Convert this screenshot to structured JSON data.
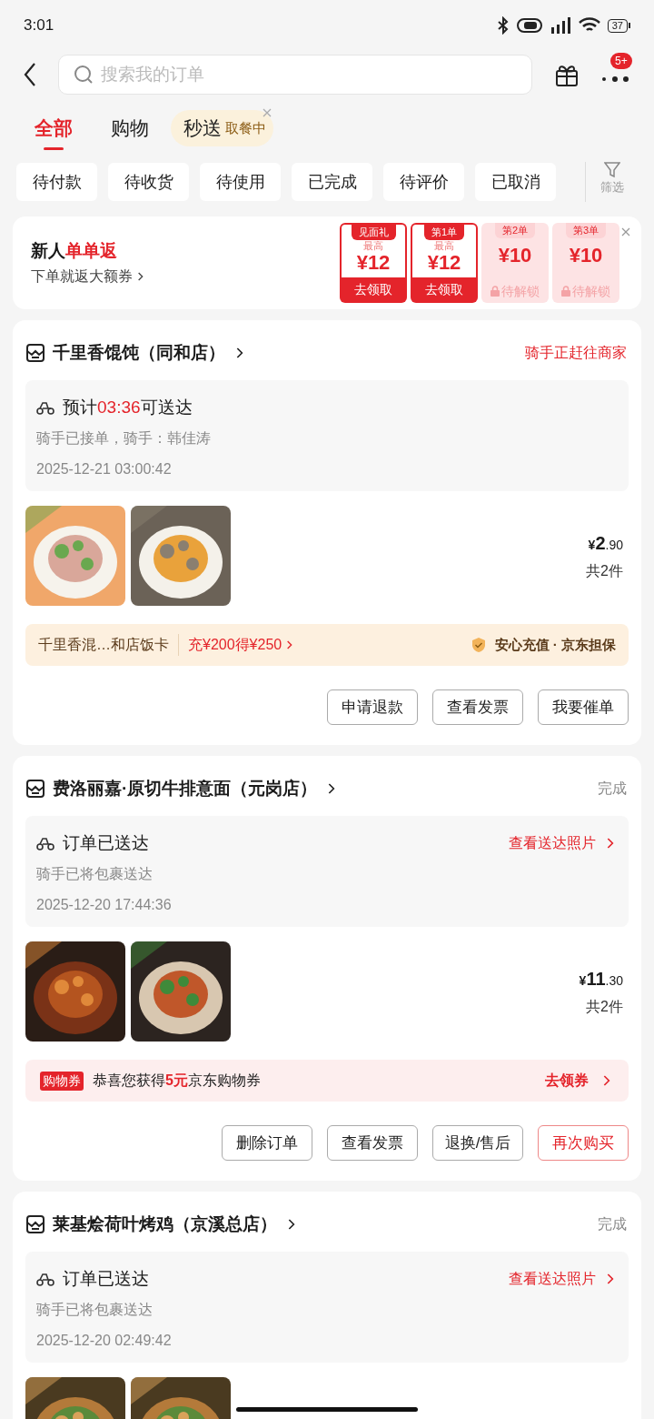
{
  "status_bar": {
    "time": "3:01",
    "battery": "37"
  },
  "search": {
    "placeholder": "搜索我的订单",
    "badge": "5+"
  },
  "tabs": [
    {
      "label": "全部",
      "selected": true
    },
    {
      "label": "购物",
      "selected": false
    },
    {
      "label": "秒送",
      "selected": false,
      "tag": "取餐中"
    }
  ],
  "filters": [
    "待付款",
    "待收货",
    "待使用",
    "已完成",
    "待评价",
    "已取消"
  ],
  "filter_button": "筛选",
  "promo": {
    "title": "新人",
    "title_highlight": "单单返",
    "subtitle": "下单就返大额券",
    "coupons": [
      {
        "header": "见面礼",
        "caption": "最高",
        "amount": "¥12",
        "action": "去领取",
        "locked": false
      },
      {
        "header": "第1单",
        "caption": "最高",
        "amount": "¥12",
        "action": "去领取",
        "locked": false
      },
      {
        "header": "第2单",
        "amount": "¥10",
        "action": "待解锁",
        "locked": true
      },
      {
        "header": "第3单",
        "amount": "¥10",
        "action": "待解锁",
        "locked": true
      }
    ]
  },
  "orders": [
    {
      "store": "千里香馄饨（同和店）",
      "status": "骑手正赶往商家",
      "status_highlight": true,
      "delivery": {
        "title": "预计",
        "time": "03:36",
        "title_end": "可送达",
        "detail": "骑手已接单，骑手：韩佳涛",
        "timestamp": "2025-12-21 03:00:42"
      },
      "images": [
        {
          "kind": "picture"
        },
        {
          "kind": "picture"
        }
      ],
      "price_symbol": "¥",
      "price_int": "2",
      "price_dec": ".90",
      "count": "共2件",
      "banner": {
        "kind": "card",
        "name": "千里香混…和店饭卡",
        "offer": "充¥200得¥250",
        "guarantee": "安心充值 · 京东担保"
      },
      "buttons": [
        {
          "label": "申请退款",
          "primary": false
        },
        {
          "label": "查看发票",
          "primary": false
        },
        {
          "label": "我要催单",
          "primary": false
        }
      ]
    },
    {
      "store": "费洛丽嘉·原切牛排意面（元岗店）",
      "status": "完成",
      "status_highlight": false,
      "delivery": {
        "title": "订单已送达",
        "link": "查看送达照片",
        "detail": "骑手已将包裹送达",
        "timestamp": "2025-12-20 17:44:36"
      },
      "images": [
        {
          "kind": "picture"
        },
        {
          "kind": "picture"
        }
      ],
      "price_symbol": "¥",
      "price_int": "11",
      "price_dec": ".30",
      "count": "共2件",
      "banner": {
        "kind": "coupon",
        "tag": "购物券",
        "text": "恭喜您获得**5元**京东购物券",
        "action": "去领券"
      },
      "buttons": [
        {
          "label": "删除订单",
          "primary": false
        },
        {
          "label": "查看发票",
          "primary": false
        },
        {
          "label": "退换/售后",
          "primary": false
        },
        {
          "label": "再次购买",
          "primary": true
        }
      ]
    },
    {
      "store": "莱基烩荷叶烤鸡（京溪总店）",
      "status": "完成",
      "status_highlight": false,
      "delivery": {
        "title": "订单已送达",
        "link": "查看送达照片",
        "detail": "骑手已将包裹送达",
        "timestamp": "2025-12-20 02:49:42"
      },
      "images": [
        {
          "kind": "picture"
        },
        {
          "kind": "picture"
        }
      ]
    }
  ]
}
